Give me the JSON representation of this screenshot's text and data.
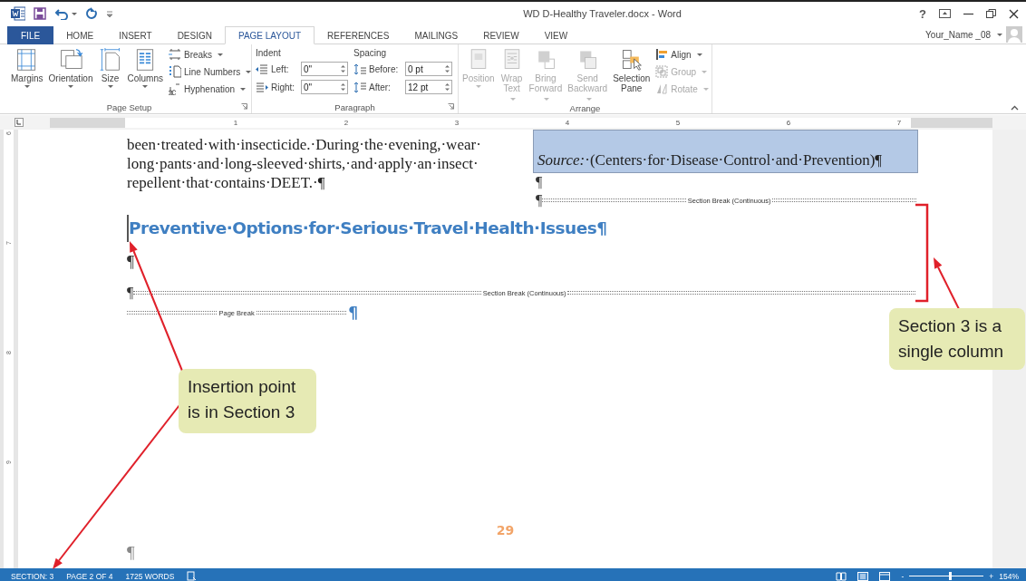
{
  "window": {
    "title": "WD D-Healthy Traveler.docx - Word",
    "help": "?"
  },
  "tabs": [
    {
      "label": "FILE",
      "kind": "file",
      "selected": false
    },
    {
      "label": "HOME",
      "kind": "tab",
      "selected": false
    },
    {
      "label": "INSERT",
      "kind": "tab",
      "selected": false
    },
    {
      "label": "DESIGN",
      "kind": "tab",
      "selected": false
    },
    {
      "label": "PAGE LAYOUT",
      "kind": "tab",
      "selected": true
    },
    {
      "label": "REFERENCES",
      "kind": "tab",
      "selected": false
    },
    {
      "label": "MAILINGS",
      "kind": "tab",
      "selected": false
    },
    {
      "label": "REVIEW",
      "kind": "tab",
      "selected": false
    },
    {
      "label": "VIEW",
      "kind": "tab",
      "selected": false
    }
  ],
  "account": {
    "name": "Your_Name _08"
  },
  "ribbon": [
    {
      "label": "Page Setup",
      "kind": "buttons",
      "launcher": true,
      "large": [
        {
          "label": "Margins",
          "dropdown": true,
          "disabled": false
        },
        {
          "label": "Orientation",
          "dropdown": true,
          "disabled": false
        },
        {
          "label": "Size",
          "dropdown": true,
          "disabled": false
        },
        {
          "label": "Columns",
          "dropdown": true,
          "disabled": false
        }
      ],
      "small": [
        {
          "label": "Breaks",
          "dropdown": true,
          "disabled": false
        },
        {
          "label": "Line Numbers",
          "dropdown": true,
          "disabled": false
        },
        {
          "label": "Hyphenation",
          "dropdown": true,
          "disabled": false
        }
      ]
    },
    {
      "label": "Paragraph",
      "kind": "fields",
      "launcher": true,
      "sections": [
        {
          "heading": "Indent",
          "fields": [
            {
              "label": "Left:",
              "value": "0\""
            },
            {
              "label": "Right:",
              "value": "0\""
            }
          ]
        },
        {
          "heading": "Spacing",
          "fields": [
            {
              "label": "Before:",
              "value": "0 pt"
            },
            {
              "label": "After:",
              "value": "12 pt"
            }
          ]
        }
      ]
    },
    {
      "label": "Arrange",
      "kind": "buttons",
      "launcher": false,
      "large": [
        {
          "label": "Position",
          "dropdown": true,
          "disabled": true
        },
        {
          "label": "Wrap Text",
          "dropdown": true,
          "disabled": true
        },
        {
          "label": "Bring Forward",
          "dropdown": true,
          "disabled": true
        },
        {
          "label": "Send Backward",
          "dropdown": true,
          "disabled": true
        },
        {
          "label": "Selection Pane",
          "dropdown": false,
          "disabled": false
        }
      ],
      "small": [
        {
          "label": "Align",
          "dropdown": true,
          "disabled": false
        },
        {
          "label": "Group",
          "dropdown": true,
          "disabled": true
        },
        {
          "label": "Rotate",
          "dropdown": true,
          "disabled": true
        }
      ]
    }
  ],
  "ruler": {
    "numbers": [
      "1",
      "2",
      "3",
      "4",
      "5",
      "6",
      "7"
    ]
  },
  "vertical_ruler": [
    "6",
    "7",
    "8",
    "9"
  ],
  "document": {
    "left_column": [
      "been·treated·with·insecticide.·During·the·evening,·wear·",
      "long·pants·and·long-sleeved·shirts,·and·apply·an·insect·",
      "repellent·that·contains·DEET.·¶"
    ],
    "shaded_text": "*Source:*·(Centers·for·Disease·Control·and·Prevention)¶",
    "right_marks": [
      "¶"
    ],
    "section_break_1": {
      "mark": "¶",
      "label": "Section Break (Continuous)"
    },
    "heading": "Preventive·Options·for·Serious·Travel·Health·Issues¶",
    "empty_paragraph": "¶",
    "section_break_2": {
      "mark": "¶",
      "label": "Section Break (Continuous)"
    },
    "page_break": {
      "label": "Page Break",
      "mark": "¶"
    },
    "page_number": "29",
    "next_page_mark": "¶"
  },
  "status_bar": {
    "items": [
      "SECTION: 3",
      "PAGE 2 OF 4",
      "1725 WORDS"
    ],
    "zoom": {
      "minus": "-",
      "plus": "+",
      "level": 0.55,
      "reading": "154%"
    }
  },
  "callouts": [
    {
      "text": "Insertion point is in Section 3"
    },
    {
      "text": "Section 3 is a single column"
    }
  ]
}
